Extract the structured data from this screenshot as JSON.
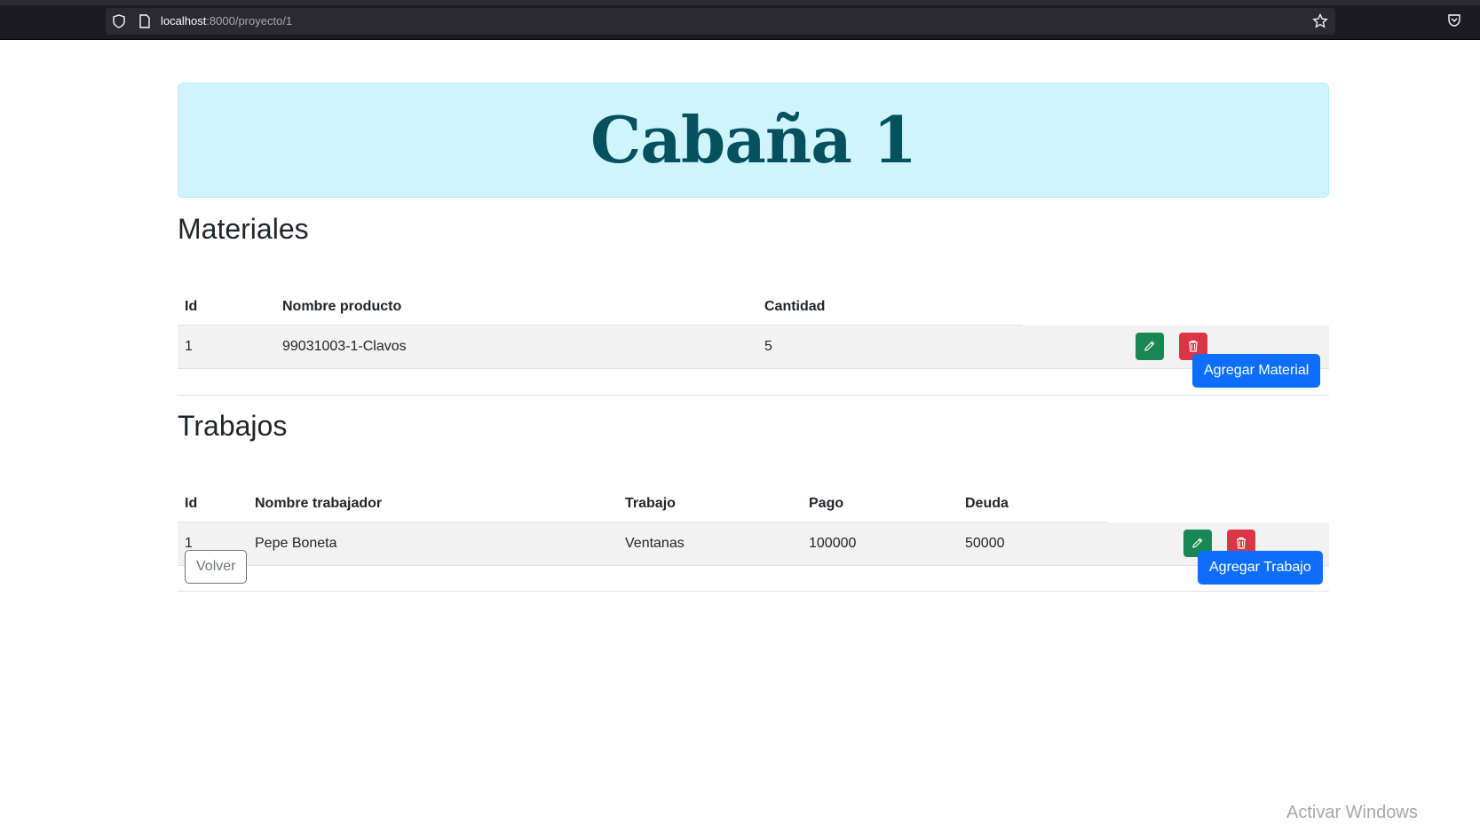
{
  "browser": {
    "url_host": "localhost",
    "url_rest": ":8000/proyecto/1"
  },
  "page": {
    "title": "Cabaña 1"
  },
  "materiales": {
    "heading": "Materiales",
    "columns": [
      "Id",
      "Nombre producto",
      "Cantidad"
    ],
    "rows": [
      {
        "id": "1",
        "nombre": "99031003-1-Clavos",
        "cantidad": "5"
      }
    ],
    "add_button": "Agregar Material"
  },
  "trabajos": {
    "heading": "Trabajos",
    "columns": [
      "Id",
      "Nombre trabajador",
      "Trabajo",
      "Pago",
      "Deuda"
    ],
    "rows": [
      {
        "id": "1",
        "nombre": "Pepe Boneta",
        "trabajo": "Ventanas",
        "pago": "100000",
        "deuda": "50000"
      }
    ],
    "back_button": "Volver",
    "add_button": "Agregar Trabajo"
  },
  "watermark": {
    "title": "Activar Windows"
  },
  "icons": {
    "edit": "pencil-icon",
    "delete": "trash-icon"
  },
  "colors": {
    "hero_bg": "#cff4fc",
    "hero_text": "#055160",
    "primary": "#0d6efd",
    "success": "#198754",
    "danger": "#dc3545"
  }
}
